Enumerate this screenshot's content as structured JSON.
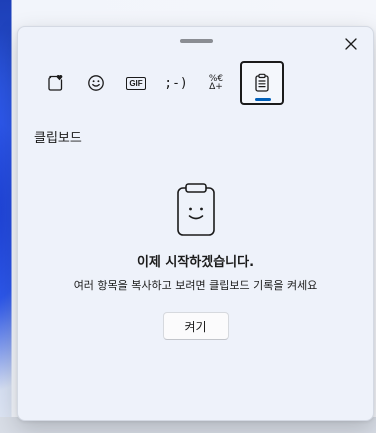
{
  "tabs": [
    {
      "id": "favorites",
      "icon": "heart-sticker-icon"
    },
    {
      "id": "emoji",
      "icon": "smiley-icon"
    },
    {
      "id": "gif",
      "icon": "gif-icon",
      "label": "GIF"
    },
    {
      "id": "kaomoji",
      "icon": "kaomoji-icon",
      "label": ";-)"
    },
    {
      "id": "symbols",
      "icon": "symbols-icon",
      "label_top": "%€",
      "label_bottom": "Δ+"
    },
    {
      "id": "clipboard",
      "icon": "clipboard-icon",
      "active": true
    }
  ],
  "section_title": "클립보드",
  "empty_state": {
    "heading": "이제 시작하겠습니다.",
    "description": "여러 항목을 복사하고 보려면 클립보드 기록을 켜세요",
    "button_label": "켜기"
  },
  "colors": {
    "accent": "#005fb8",
    "panel_bg": "#eef2fa",
    "text": "#1b1b1b"
  }
}
